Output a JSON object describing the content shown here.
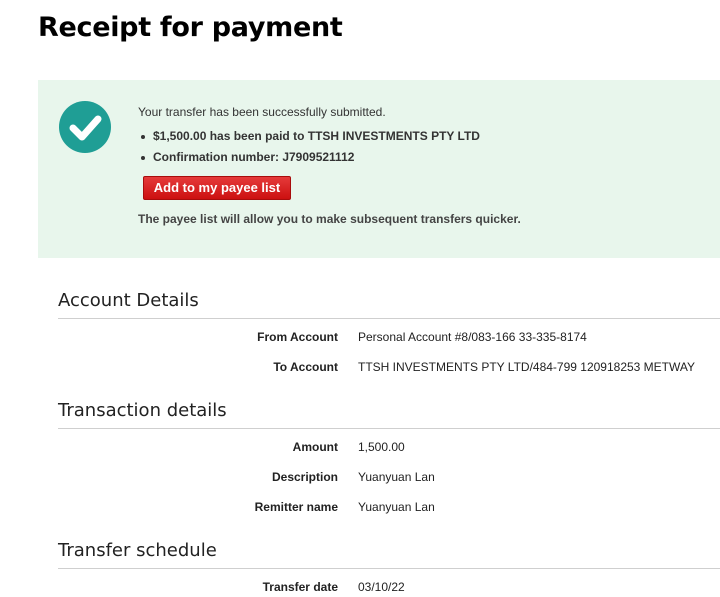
{
  "page": {
    "title": "Receipt for payment"
  },
  "success": {
    "message": "Your transfer has been successfully submitted.",
    "bullets": [
      "$1,500.00 has been paid to TTSH INVESTMENTS PTY LTD",
      "Confirmation number: J7909521112"
    ],
    "button_label": "Add to my payee list",
    "note": "The payee list will allow you to make subsequent transfers quicker.",
    "icon": "checkmark-circle-icon",
    "accent_color": "#1f9e95",
    "panel_color": "#e8f6ec",
    "button_color": "#d61f1f"
  },
  "account_details": {
    "heading": "Account Details",
    "rows": [
      {
        "label": "From Account",
        "value": "Personal Account #8/083-166 33-335-8174"
      },
      {
        "label": "To Account",
        "value": "TTSH INVESTMENTS PTY LTD/484-799 120918253 METWAY"
      }
    ]
  },
  "transaction_details": {
    "heading": "Transaction details",
    "rows": [
      {
        "label": "Amount",
        "value": "1,500.00"
      },
      {
        "label": "Description",
        "value": "Yuanyuan Lan"
      },
      {
        "label": "Remitter name",
        "value": "Yuanyuan Lan"
      }
    ]
  },
  "transfer_schedule": {
    "heading": "Transfer schedule",
    "rows": [
      {
        "label": "Transfer date",
        "value": "03/10/22"
      }
    ]
  }
}
